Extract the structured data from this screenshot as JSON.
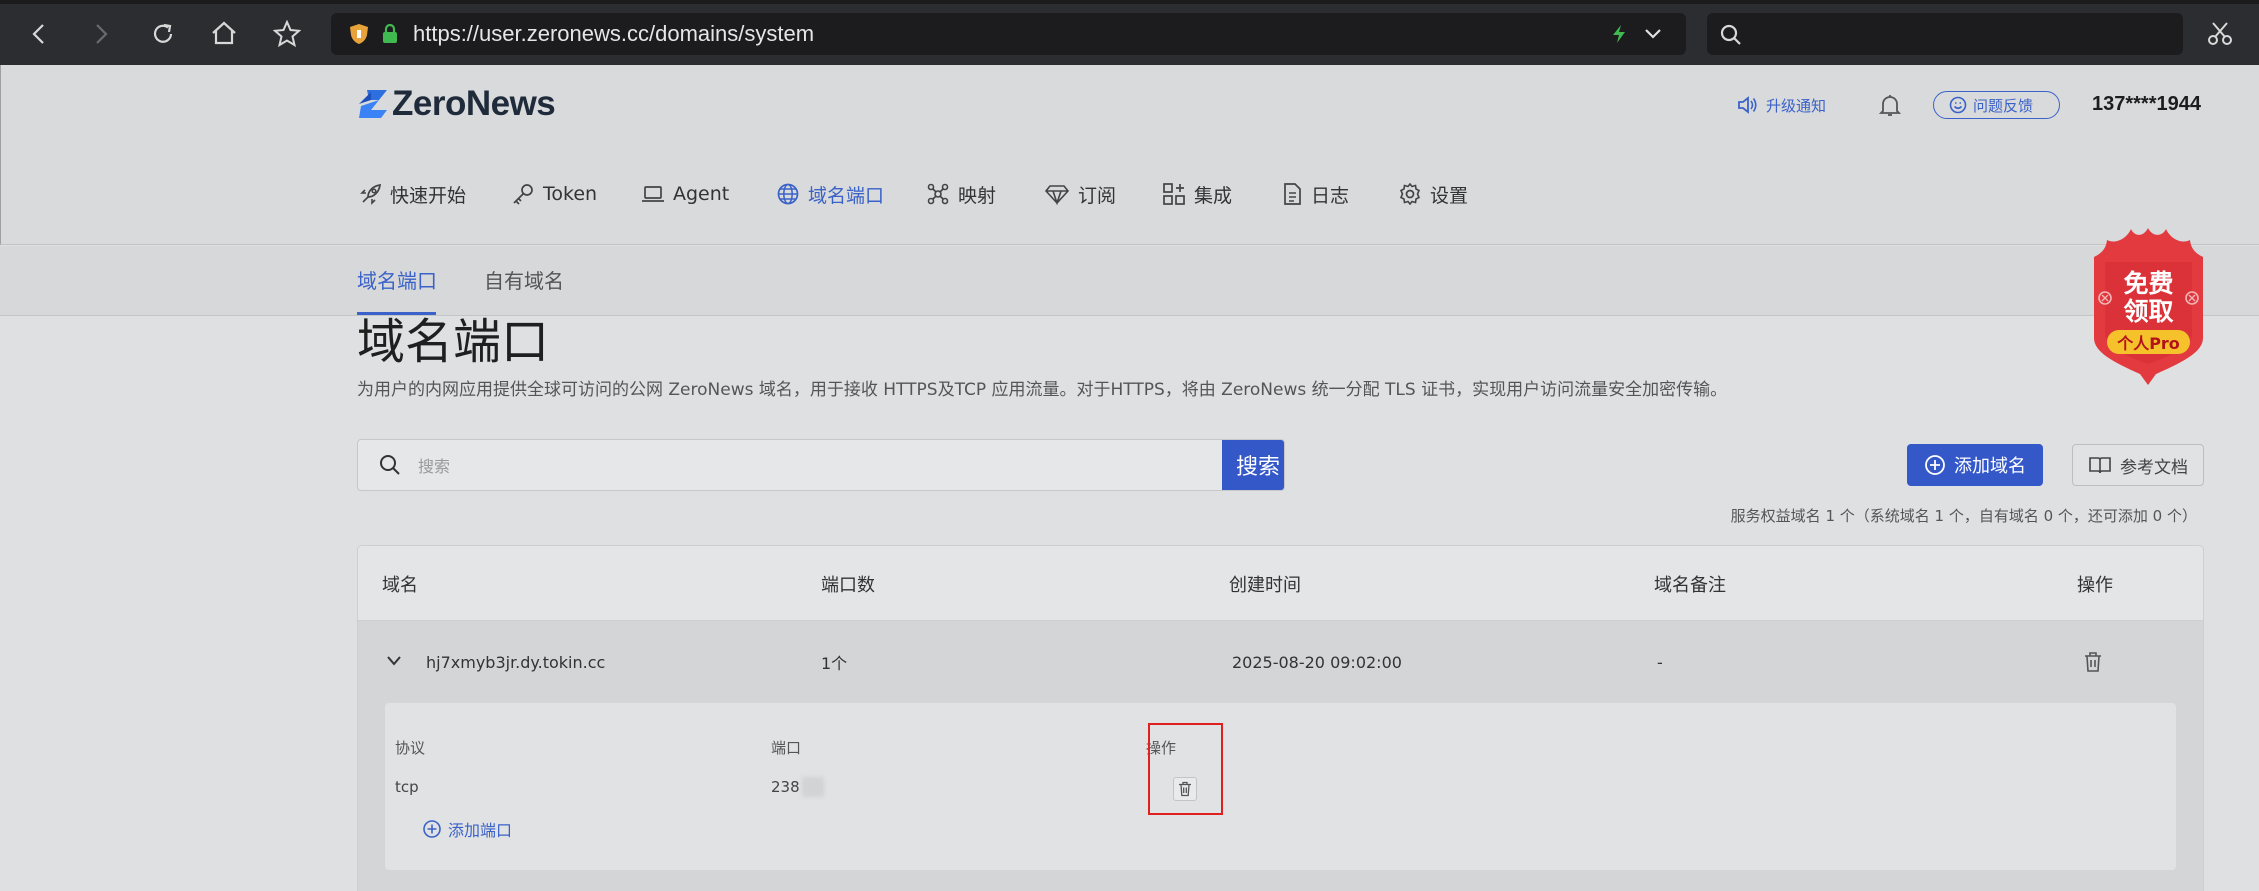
{
  "browser": {
    "url": "https://user.zeronews.cc/domains/system",
    "search_value": ""
  },
  "header": {
    "logo": "ZeroNews",
    "upgrade_notice": "升级通知",
    "feedback": "问题反馈",
    "user": "137****1944"
  },
  "nav": [
    {
      "label": "快速开始",
      "icon": "rocket-icon"
    },
    {
      "label": "Token",
      "icon": "key-icon"
    },
    {
      "label": "Agent",
      "icon": "laptop-icon"
    },
    {
      "label": "域名端口",
      "icon": "globe-icon",
      "active": true
    },
    {
      "label": "映射",
      "icon": "network-icon"
    },
    {
      "label": "订阅",
      "icon": "diamond-icon"
    },
    {
      "label": "集成",
      "icon": "grid-plus-icon"
    },
    {
      "label": "日志",
      "icon": "document-icon"
    },
    {
      "label": "设置",
      "icon": "gear-icon"
    }
  ],
  "tabs": [
    {
      "label": "域名端口",
      "active": true
    },
    {
      "label": "自有域名",
      "active": false
    }
  ],
  "promo": {
    "line1": "免费",
    "line2": "领取",
    "tag": "个人Pro"
  },
  "page": {
    "title": "域名端口",
    "description": "为用户的内网应用提供全球可访问的公网 ZeroNews 域名，用于接收 HTTPS及TCP 应用流量。对于HTTPS，将由 ZeroNews 统一分配 TLS 证书，实现用户访问流量安全加密传输。"
  },
  "search": {
    "placeholder": "搜索",
    "button": "搜索"
  },
  "actions": {
    "add_domain": "添加域名",
    "docs": "参考文档"
  },
  "quota": "服务权益域名 1 个（系统域名 1 个，自有域名 0 个，还可添加 0 个）",
  "table": {
    "headers": [
      "域名",
      "端口数",
      "创建时间",
      "域名备注",
      "操作"
    ],
    "rows": [
      {
        "domain": "hj7xmyb3jr.dy.tokin.cc",
        "ports": "1个",
        "created": "2025-08-20 09:02:00",
        "note": "-"
      }
    ]
  },
  "ports": {
    "headers": [
      "协议",
      "端口",
      "操作"
    ],
    "rows": [
      {
        "protocol": "tcp",
        "port": "238"
      }
    ],
    "add_label": "添加端口"
  },
  "colors": {
    "accent": "#3a62c8",
    "primary_button": "#3558c9",
    "highlight": "#e0201e",
    "promo_red": "#e23a3f",
    "promo_tag": "#f6c22c"
  }
}
